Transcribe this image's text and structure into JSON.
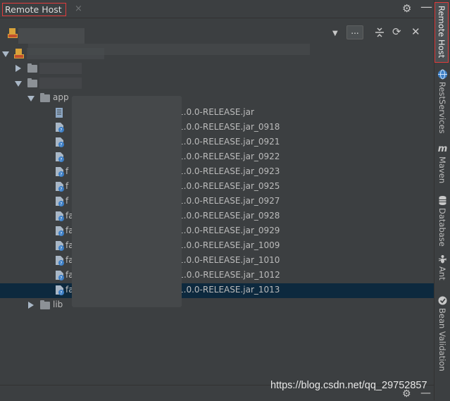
{
  "panel": {
    "title": "Remote Host",
    "close_glyph": "×",
    "gear_glyph": "⚙",
    "minimize_glyph": "—"
  },
  "toolbar": {
    "dropdown_glyph": "▼",
    "more_label": "...",
    "refresh_glyph": "⟳",
    "close_glyph": "✕",
    "icons": [
      "sftp-icon",
      "dropdown-icon",
      "more-button",
      "collapse-icon",
      "refresh-icon",
      "close-icon"
    ]
  },
  "tree": {
    "folders": [
      {
        "label": "app",
        "state": "expanded"
      },
      {
        "label": "lib",
        "state": "collapsed"
      }
    ],
    "files": [
      {
        "label_left": "",
        "label_right": "1.0.0-RELEASE.jar",
        "icon": "jar-icon"
      },
      {
        "label_left": "",
        "label_right": "1.0.0-RELEASE.jar_0918",
        "icon": "unknown-file-icon"
      },
      {
        "label_left": "",
        "label_right": "1.0.0-RELEASE.jar_0921",
        "icon": "unknown-file-icon"
      },
      {
        "label_left": "",
        "label_right": "1.0.0-RELEASE.jar_0922",
        "icon": "unknown-file-icon"
      },
      {
        "label_left": "f",
        "label_right": "1.0.0-RELEASE.jar_0923",
        "icon": "unknown-file-icon"
      },
      {
        "label_left": "f",
        "label_right": "1.0.0-RELEASE.jar_0925",
        "icon": "unknown-file-icon"
      },
      {
        "label_left": "f",
        "label_right": "1.0.0-RELEASE.jar_0927",
        "icon": "unknown-file-icon"
      },
      {
        "label_left": "fa",
        "label_right": "1.0.0-RELEASE.jar_0928",
        "icon": "unknown-file-icon"
      },
      {
        "label_left": "fa",
        "label_right": "1.0.0-RELEASE.jar_0929",
        "icon": "unknown-file-icon"
      },
      {
        "label_left": "fa",
        "label_right": "1.0.0-RELEASE.jar_1009",
        "icon": "unknown-file-icon"
      },
      {
        "label_left": "fa",
        "label_right": "1.0.0-RELEASE.jar_1010",
        "icon": "unknown-file-icon"
      },
      {
        "label_left": "fa",
        "label_right": "-1.0.0-RELEASE.jar_1012",
        "icon": "unknown-file-icon"
      },
      {
        "label_left": "fa",
        "label_right": "1.0.0-RELEASE.jar_1013",
        "icon": "unknown-file-icon",
        "selected": true
      }
    ]
  },
  "right_toolbar": {
    "tabs": [
      {
        "label": "Remote Host",
        "icon": "",
        "active": true
      },
      {
        "label": "RestServices",
        "icon": "globe-icon"
      },
      {
        "label": "Maven",
        "icon": "maven-icon",
        "glyph": "m"
      },
      {
        "label": "Database",
        "icon": "database-icon"
      },
      {
        "label": "Ant",
        "icon": "ant-icon"
      },
      {
        "label": "Bean Validation",
        "icon": "bean-validation-icon"
      }
    ]
  },
  "watermark": "https://blog.csdn.net/qq_29752857",
  "colors": {
    "background": "#3c3f41",
    "selection": "#0d293e",
    "highlight_box": "#e03c3c",
    "text": "#bbbbbb"
  }
}
